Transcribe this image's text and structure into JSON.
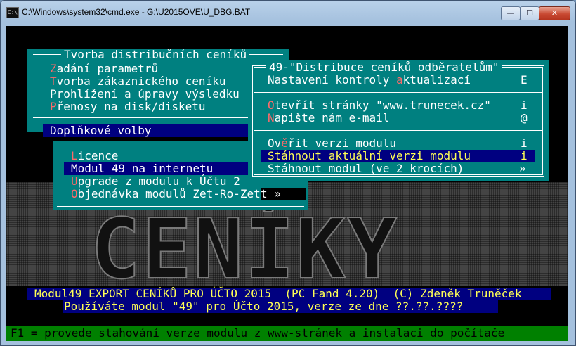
{
  "window": {
    "title": "C:\\Windows\\system32\\cmd.exe - G:\\U2015OVE\\U_DBG.BAT",
    "icon": "cmd-icon",
    "min_label": "—",
    "max_label": "☐",
    "close_label": "✕"
  },
  "menu_main": {
    "title": "Tvorba distribučních ceníků",
    "items": [
      {
        "hot": "Z",
        "rest": "adání parametrů"
      },
      {
        "hot": "T",
        "rest": "vorba zákaznického ceníku"
      },
      {
        "hot": "",
        "rest": "Prohlížení a úpravy výsledku"
      },
      {
        "hot": "P",
        "rest": "řenosy na disk/disketu"
      }
    ],
    "selected": "Doplňkové volby"
  },
  "menu_doplnkove": {
    "items": [
      {
        "hot": "L",
        "rest": "icence",
        "selected": false
      },
      {
        "hot": "",
        "rest": "Modul 49 na internetu",
        "selected": true
      },
      {
        "hot": "U",
        "rest": "pgrade z modulu k Účtu 2",
        "selected": false
      },
      {
        "hot": "O",
        "rest": "bjednávka modulů Zet-Ro-Zet",
        "selected": false
      }
    ],
    "arrow": "t »"
  },
  "menu_distribuce": {
    "title": "49-\"Distribuce ceníků odběratelům\"",
    "groups": [
      [
        {
          "pre": "Nastavení kontroly ",
          "hot": "a",
          "post": "ktualizací",
          "key": "E",
          "selected": false
        }
      ],
      [
        {
          "pre": "",
          "hot": "O",
          "post": "tevřít stránky \"www.trunecek.cz\"",
          "key": "i",
          "selected": false
        },
        {
          "pre": "",
          "hot": "N",
          "post": "apište nám e-mail",
          "key": "@",
          "selected": false
        }
      ],
      [
        {
          "pre": "Ov",
          "hot": "ě",
          "post": "řit verzi modulu",
          "key": "i",
          "selected": false
        },
        {
          "pre": "Stáhnout aktuální verzi modulu",
          "hot": "",
          "post": "",
          "key": "i",
          "selected": true
        },
        {
          "pre": "Stáhnout modul (ve 2 krocích)",
          "hot": "",
          "post": "",
          "key": "»",
          "selected": false
        }
      ]
    ]
  },
  "background_word": "CENÍKY",
  "status": {
    "line1": "Modul49 EXPORT CENÍKŮ PRO ÚČTO 2015  (PC Fand 4.20)  (C) Zdeněk Truněček",
    "line2": "Používáte modul \"49\" pro Účto 2015, verze ze dne ??.??.????"
  },
  "help": "F1 = provede stahování verze modulu z www-stránek a instalaci do počítače",
  "colors": {
    "panel": "#008080",
    "selection": "#000080",
    "hotkey": "#ff6a6a",
    "help_bar": "#008000"
  }
}
